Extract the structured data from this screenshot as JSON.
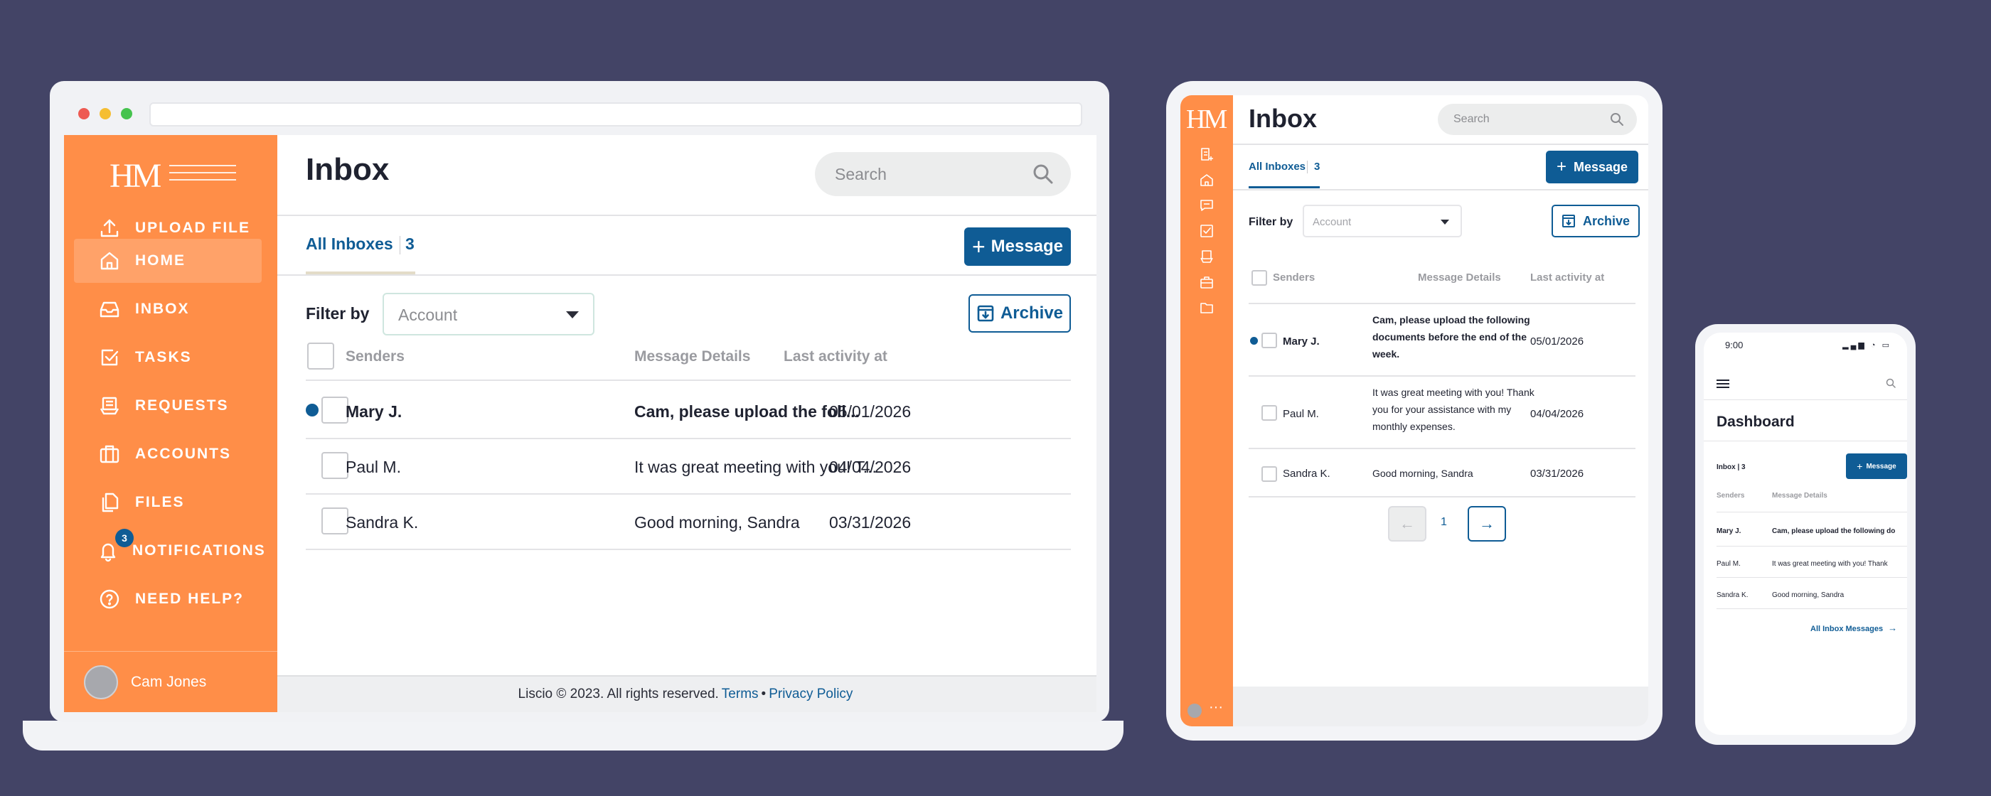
{
  "laptop": {
    "logo": "HM",
    "nav": [
      {
        "label": "UPLOAD FILE",
        "icon": "upload-icon"
      },
      {
        "label": "HOME",
        "icon": "home-icon"
      },
      {
        "label": "INBOX",
        "icon": "inbox-icon"
      },
      {
        "label": "TASKS",
        "icon": "tasks-icon"
      },
      {
        "label": "REQUESTS",
        "icon": "requests-icon"
      },
      {
        "label": "ACCOUNTS",
        "icon": "accounts-icon"
      },
      {
        "label": "FILES",
        "icon": "files-icon"
      },
      {
        "label": "NOTIFICATIONS",
        "icon": "bell-icon",
        "badge": "3"
      },
      {
        "label": "NEED HELP?",
        "icon": "help-icon"
      }
    ],
    "user_name": "Cam Jones",
    "title": "Inbox",
    "search_placeholder": "Search",
    "tab_label": "All Inboxes",
    "tab_count": "3",
    "message_button": "Message",
    "filter_label": "Filter by",
    "filter_placeholder": "Account",
    "archive_button": "Archive",
    "columns": {
      "senders": "Senders",
      "details": "Message Details",
      "activity": "Last activity at"
    },
    "rows": [
      {
        "sender": "Mary J.",
        "details": "Cam, please upload the foll...",
        "date": "05/01/2026"
      },
      {
        "sender": "Paul M.",
        "details": "It was great meeting with you! T...",
        "date": "04/04/2026"
      },
      {
        "sender": "Sandra K.",
        "details": "Good morning, Sandra",
        "date": "03/31/2026"
      }
    ],
    "footer_text": "Liscio © 2023. All rights reserved.",
    "footer_terms": "Terms",
    "footer_sep": "•",
    "footer_privacy": "Privacy Policy"
  },
  "tablet": {
    "logo": "HM",
    "title": "Inbox",
    "search_placeholder": "Search",
    "tab_label": "All Inboxes",
    "tab_count": "3",
    "message_button": "Message",
    "filter_label": "Filter by",
    "filter_placeholder": "Account",
    "archive_button": "Archive",
    "columns": {
      "senders": "Senders",
      "details": "Message Details",
      "activity": "Last activity at"
    },
    "rows": [
      {
        "sender": "Mary J.",
        "details": "Cam, please upload the following documents before the end of the week.",
        "date": "05/01/2026"
      },
      {
        "sender": "Paul M.",
        "details": "It was great meeting with you! Thank you for your assistance with my monthly expenses.",
        "date": "04/04/2026"
      },
      {
        "sender": "Sandra K.",
        "details": "Good morning, Sandra",
        "date": "03/31/2026"
      }
    ],
    "page_number": "1",
    "rail_more": "···"
  },
  "phone": {
    "time": "9:00",
    "title": "Dashboard",
    "inbox_label": "Inbox | 3",
    "message_button": "Message",
    "columns": {
      "senders": "Senders",
      "details": "Message Details"
    },
    "rows": [
      {
        "sender": "Mary J.",
        "details": "Cam, please upload the following  do"
      },
      {
        "sender": "Paul M.",
        "details": "It was great meeting with you! Thank"
      },
      {
        "sender": "Sandra K.",
        "details": "Good morning, Sandra"
      }
    ],
    "all_messages_link": "All Inbox Messages"
  },
  "colors": {
    "background": "#434466",
    "sidebar": "#ff8e48",
    "accent": "#0f5c95"
  }
}
